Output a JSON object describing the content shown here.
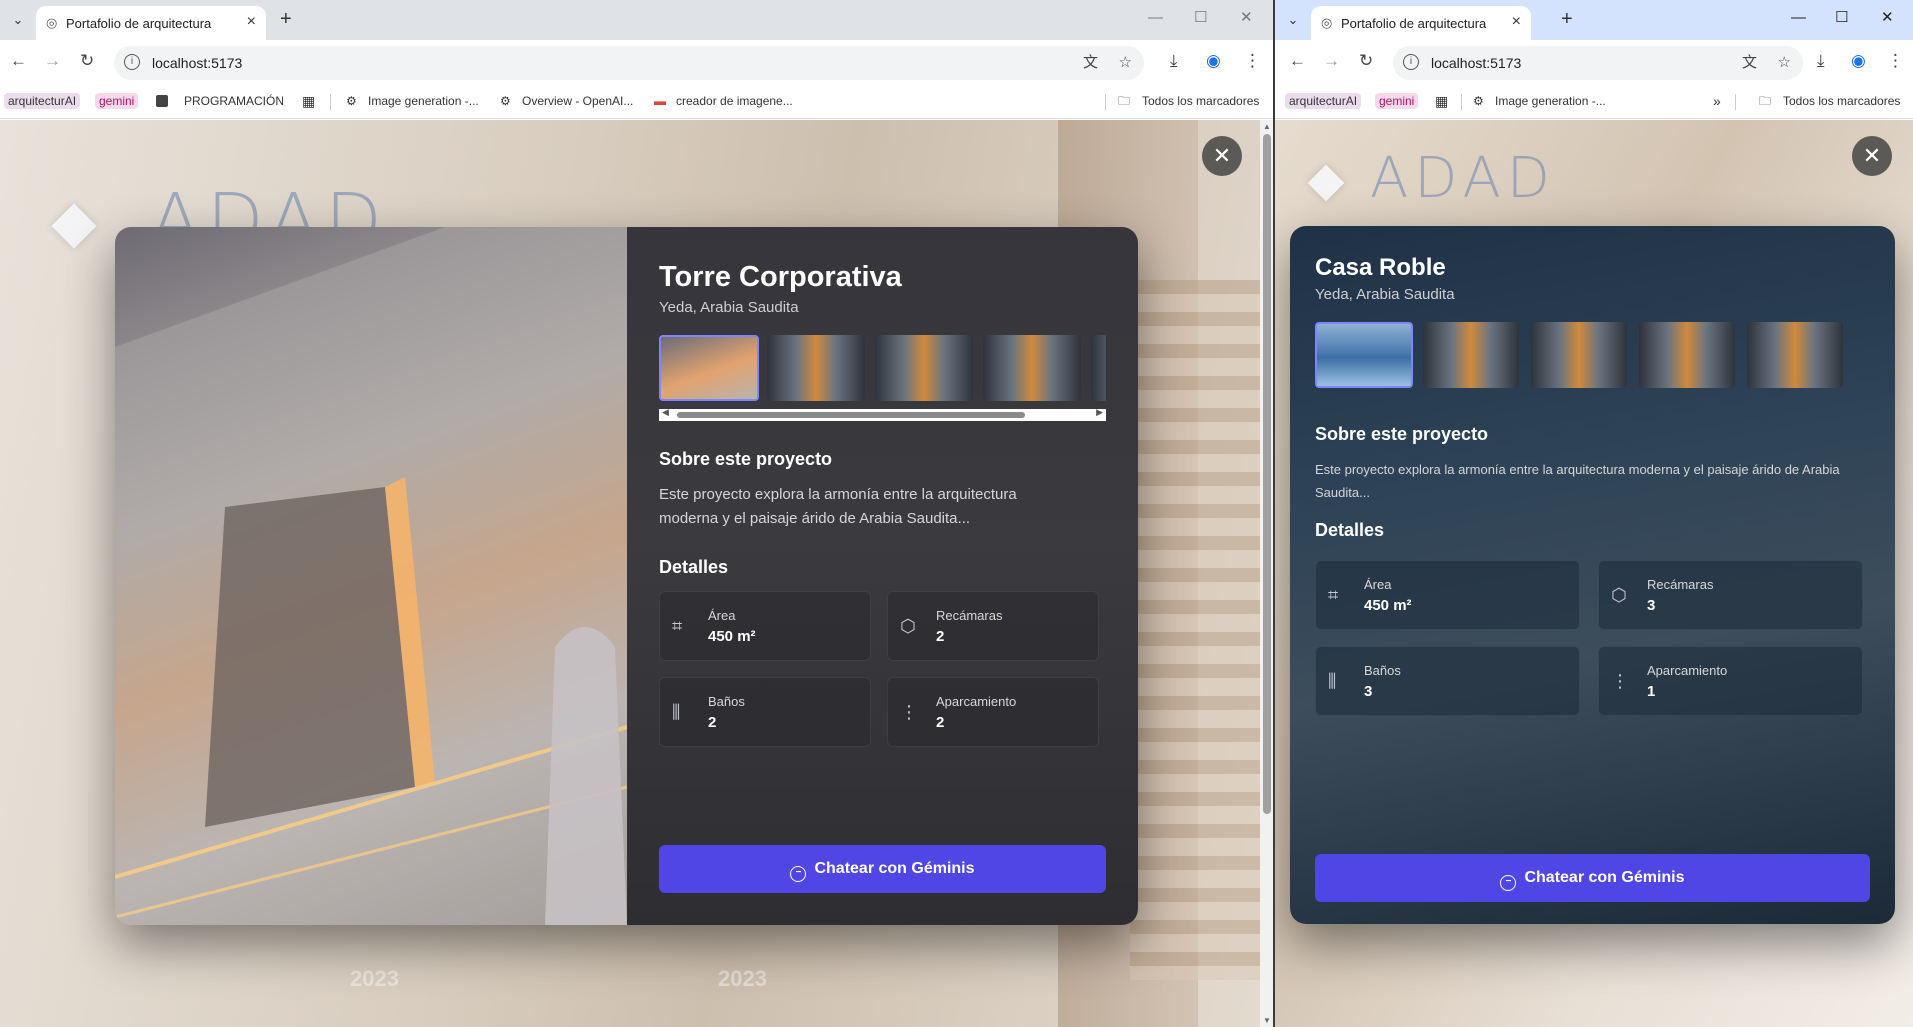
{
  "colors": {
    "accent": "#4f46e5",
    "selected_thumb_border": "#7e86ff"
  },
  "left": {
    "tab": {
      "title": "Portafolio de arquitectura"
    },
    "url": "localhost:5173",
    "bookmarks": {
      "b1": "arquitecturAI",
      "b2": "gemini",
      "b3": "PROGRAMACIÓN",
      "b4": "Image generation -...",
      "b5": "Overview - OpenAI...",
      "b6": "creador de imagene...",
      "all": "Todos los marcadores"
    },
    "page": {
      "logo": "ADAD",
      "years": [
        "2023",
        "2023"
      ]
    },
    "modal": {
      "title": "Torre Corporativa",
      "location": "Yeda, Arabia Saudita",
      "about_heading": "Sobre este proyecto",
      "about_text": "Este proyecto explora la armonía entre la arquitectura moderna y el paisaje árido de Arabia Saudita...",
      "details_heading": "Detalles",
      "details": [
        {
          "label": "Área",
          "value": "450 m²",
          "icon": "area-icon"
        },
        {
          "label": "Recámaras",
          "value": "2",
          "icon": "cube-icon"
        },
        {
          "label": "Baños",
          "value": "2",
          "icon": "bath-icon"
        },
        {
          "label": "Aparcamiento",
          "value": "2",
          "icon": "more-icon"
        }
      ],
      "chat_button": "Chatear con Géminis"
    }
  },
  "right": {
    "tab": {
      "title": "Portafolio de arquitectura"
    },
    "url": "localhost:5173",
    "bookmarks": {
      "b1": "arquitecturAI",
      "b2": "gemini",
      "b4": "Image generation -...",
      "all": "Todos los marcadores"
    },
    "page": {
      "logo": "ADAD"
    },
    "modal": {
      "title": "Casa Roble",
      "location": "Yeda, Arabia Saudita",
      "about_heading": "Sobre este proyecto",
      "about_text": "Este proyecto explora la armonía entre la arquitectura moderna y el paisaje árido de Arabia Saudita...",
      "details_heading": "Detalles",
      "details": [
        {
          "label": "Área",
          "value": "450 m²",
          "icon": "area-icon"
        },
        {
          "label": "Recámaras",
          "value": "3",
          "icon": "cube-icon"
        },
        {
          "label": "Baños",
          "value": "3",
          "icon": "bath-icon"
        },
        {
          "label": "Aparcamiento",
          "value": "1",
          "icon": "more-icon"
        }
      ],
      "chat_button": "Chatear con Géminis"
    }
  }
}
